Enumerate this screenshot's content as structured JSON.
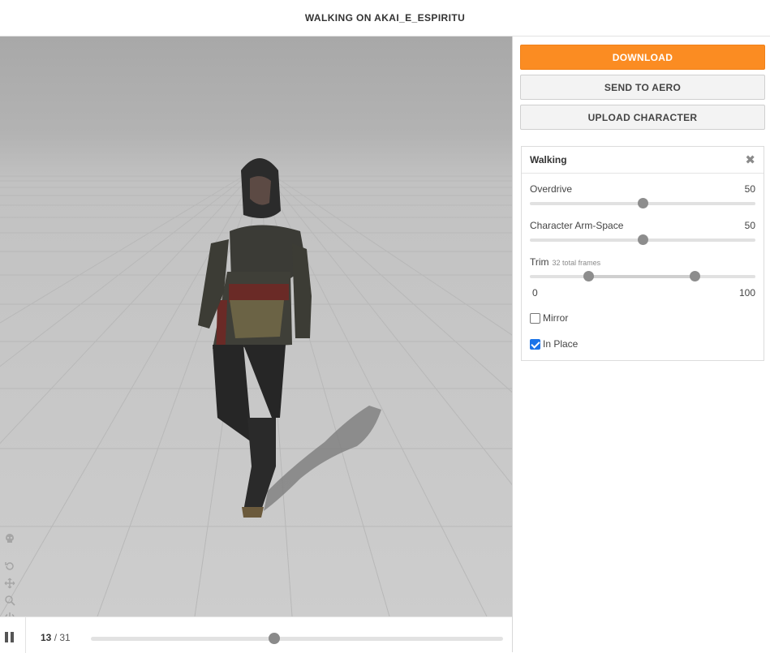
{
  "title": "WALKING ON AKAI_E_ESPIRITU",
  "actions": {
    "download": "DOWNLOAD",
    "send_to_aero": "SEND TO AERO",
    "upload_character": "UPLOAD CHARACTER"
  },
  "panel": {
    "title": "Walking",
    "close": "✖",
    "overdrive": {
      "label": "Overdrive",
      "value": "50",
      "fraction": 0.5
    },
    "arm_space": {
      "label": "Character Arm-Space",
      "value": "50",
      "fraction": 0.5
    },
    "trim": {
      "label": "Trim",
      "sublabel": "32 total frames",
      "start_fraction": 0.26,
      "end_fraction": 0.73,
      "min_label": "0",
      "max_label": "100"
    },
    "mirror": {
      "label": "Mirror",
      "checked": false
    },
    "in_place": {
      "label": "In Place",
      "checked": true
    }
  },
  "timeline": {
    "current_frame": "13",
    "total_frames": "/ 31",
    "progress_fraction": 0.445
  },
  "colors": {
    "accent": "#fb8c22",
    "checkbox": "#1a73e8"
  },
  "tool_icons": [
    "skull-icon",
    "rotate-icon",
    "move-icon",
    "zoom-icon",
    "power-icon",
    "camera-icon"
  ]
}
